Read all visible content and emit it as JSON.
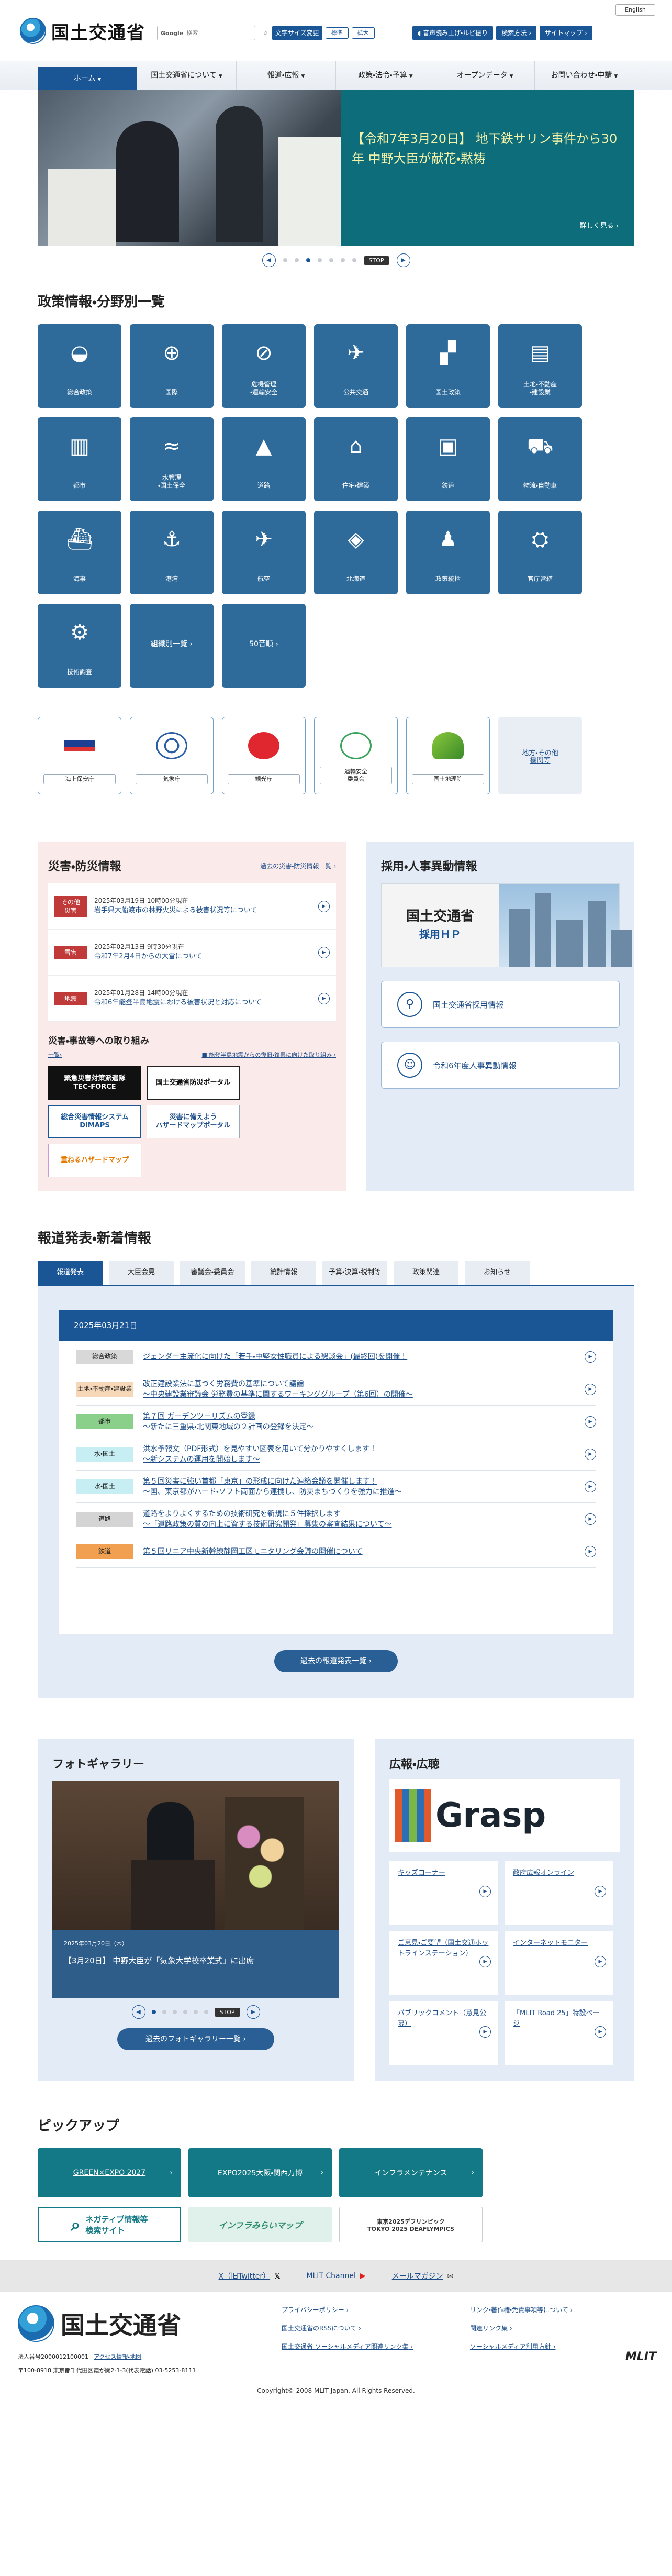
{
  "header": {
    "lang": "English",
    "logo": "国土交通省",
    "search_brand": "Google",
    "search_placeholder": "検索",
    "font_size_label": "文字サイズ変更",
    "font_std": "標準",
    "font_big": "拡大",
    "voice": "音声読み上げ・ルビ振り",
    "guide": "検索方法",
    "sitemap": "サイトマップ"
  },
  "nav": [
    "ホーム",
    "国土交通省について",
    "報道・広報",
    "政策・法令・予算",
    "オープンデータ",
    "お問い合わせ・申請"
  ],
  "hero": {
    "caption": "【令和7年3月20日】 地下鉄サリン事件から30年 中野大臣が献花・黙祷",
    "more": "詳しく見る",
    "stop": "STOP"
  },
  "policy": {
    "title": "政策情報・分野別一覧",
    "tiles": [
      {
        "label": "総合政策",
        "icon": "◒"
      },
      {
        "label": "国際",
        "icon": "⊕"
      },
      {
        "label": "危機管理\n・運輸安全",
        "icon": "⊘"
      },
      {
        "label": "公共交通",
        "icon": "✈"
      },
      {
        "label": "国土政策",
        "icon": "▞"
      },
      {
        "label": "土地・不動産\n・建設業",
        "icon": "▤"
      },
      {
        "label": "都市",
        "icon": "▥"
      },
      {
        "label": "水管理\n・国土保全",
        "icon": "≈"
      },
      {
        "label": "道路",
        "icon": "▲"
      },
      {
        "label": "住宅・建築",
        "icon": "⌂"
      },
      {
        "label": "鉄道",
        "icon": "▣"
      },
      {
        "label": "物流・自動車",
        "icon": "⛟"
      },
      {
        "label": "海事",
        "icon": "⛴"
      },
      {
        "label": "港湾",
        "icon": "⚓"
      },
      {
        "label": "航空",
        "icon": "✈"
      },
      {
        "label": "北海道",
        "icon": "◈"
      },
      {
        "label": "政策統括",
        "icon": "♟"
      },
      {
        "label": "官庁営繕",
        "icon": "⛭"
      },
      {
        "label": "技術調査",
        "icon": "⚙"
      }
    ],
    "text_tiles": [
      "組織別一覧",
      "50音順"
    ]
  },
  "agencies": [
    {
      "label": "海上保安庁",
      "logo": "JCG"
    },
    {
      "label": "気象庁",
      "logo": ""
    },
    {
      "label": "観光庁",
      "logo": ""
    },
    {
      "label": "運輸安全\n委員会",
      "logo": "JTSB"
    },
    {
      "label": "国土地理院",
      "logo": "GSI"
    },
    {
      "label": "地方・その他\n機関等",
      "logo": ""
    }
  ],
  "disaster": {
    "title": "災害・防災情報",
    "link": "過去の災害・防災情報一覧",
    "items": [
      {
        "tag": "その他\n災害",
        "date": "2025年03月19日 10時00分現在",
        "text": "岩手県大船渡市の林野火災による被害状況等について"
      },
      {
        "tag": "雪害",
        "date": "2025年02月13日 9時30分現在",
        "text": "令和7年2月4日からの大雪について"
      },
      {
        "tag": "地震",
        "date": "2025年01月28日 14時00分現在",
        "text": "令和6年能登半島地震における被害状況と対応について"
      }
    ],
    "sub_title": "災害・事故等への取り組み",
    "sub_link": "一覧",
    "sub_link2": "能登半島地震からの復旧・復興に向けた取り組み",
    "banners": [
      "緊急災害対策派遣隊\nTEC-FORCE",
      "国土交通省防災ポータル",
      "総合災害情報システム\nDIMAPS",
      "災害に備えよう\nハザードマップポータル",
      "重ねるハザードマップ"
    ]
  },
  "recruit": {
    "title": "採用・人事異動情報",
    "banner_main": "国土交通省",
    "banner_sub": "採用ＨＰ",
    "btn1": "国土交通省採用情報",
    "btn2": "令和6年度人事異動情報"
  },
  "press": {
    "title": "報道発表・新着情報",
    "tabs": [
      "報道発表",
      "大臣会見",
      "審議会・委員会",
      "統計情報",
      "予算・決算・税制等",
      "政策関連",
      "お知らせ"
    ],
    "date": "2025年03月21日",
    "items": [
      {
        "tag": "総合政策",
        "color": "#d8d8d8",
        "text": "ジェンダー主流化に向けた「若手・中堅女性職員による懇談会」(最終回)を開催！"
      },
      {
        "tag": "土地・不動産・建設業",
        "color": "#f6d7b8",
        "text": "改正建設業法に基づく労務費の基準について議論\n～中央建設業審議会 労務費の基準に関するワーキンググループ（第6回）の開催～"
      },
      {
        "tag": "都市",
        "color": "#8ad08a",
        "text": "第７回 ガーデンツーリズムの登録\n～新たに三重県・北関東地域の２計画の登録を決定～"
      },
      {
        "tag": "水・国土",
        "color": "#c7eef2",
        "text": "洪水予報文（PDF形式）を見やすい図表を用いて分かりやすくします！\n～新システムの運用を開始します～"
      },
      {
        "tag": "水・国土",
        "color": "#c7eef2",
        "text": "第５回災害に強い首都「東京」の形成に向けた連絡会議を開催します！\n～国、東京都がハード・ソフト両面から連携し、防災まちづくりを強力に推進～"
      },
      {
        "tag": "道路",
        "color": "#d4d4d4",
        "text": "道路をよりよくするための技術研究を新規に５件採択します\n～「道路政策の質の向上に資する技術研究開発」募集の審査結果について～"
      },
      {
        "tag": "鉄道",
        "color": "#f0a050",
        "text": "第５回リニア中央新幹線静岡工区モニタリング会議の開催について"
      }
    ],
    "more": "過去の報道発表一覧"
  },
  "photo": {
    "title": "フォトギャラリー",
    "date": "2025年03月20日（木）",
    "caption": "【3月20日】 中野大臣が「気象大学校卒業式」に出席",
    "stop": "STOP",
    "more": "過去のフォトギャラリー一覧"
  },
  "pr": {
    "title": "広報・広聴",
    "grasp": "Grasp",
    "items": [
      "キッズコーナー",
      "政府広報オンライン",
      "ご意見・ご要望（国土交通ホットラインステーション）",
      "インターネットモニター",
      "パブリックコメント（意見公募）",
      "「MLIT Road 25」特設ページ"
    ]
  },
  "pickup": {
    "title": "ピックアップ",
    "buttons": [
      "GREEN×EXPO 2027",
      "EXPO2025大阪・関西万博",
      "インフラメンテナンス"
    ],
    "banners": [
      "ネガティブ情報等\n検索サイト",
      "インフラみらいマップ",
      "東京2025デフリンピック\nTOKYO 2025 DEAFLYMPICS"
    ]
  },
  "social": [
    "X（旧Twitter）",
    "MLIT Channel",
    "メールマガジン"
  ],
  "footer": {
    "logo": "国土交通省",
    "corp_no": "法人番号2000012100001",
    "access": "アクセス情報・地図",
    "address": "〒100-8918 東京都千代田区霞が関2-1-3(代表電話) 03-5253-8111",
    "links": [
      "プライバシーポリシー",
      "リンク・著作権・免責事項等について",
      "国土交通省のRSSについて",
      "関連リンク集",
      "国土交通省 ソーシャルメディア関連リンク集",
      "ソーシャルメディア利用方針"
    ],
    "mlit": "MLIT",
    "copyright": "Copyright© 2008 MLIT Japan. All Rights Reserved."
  }
}
